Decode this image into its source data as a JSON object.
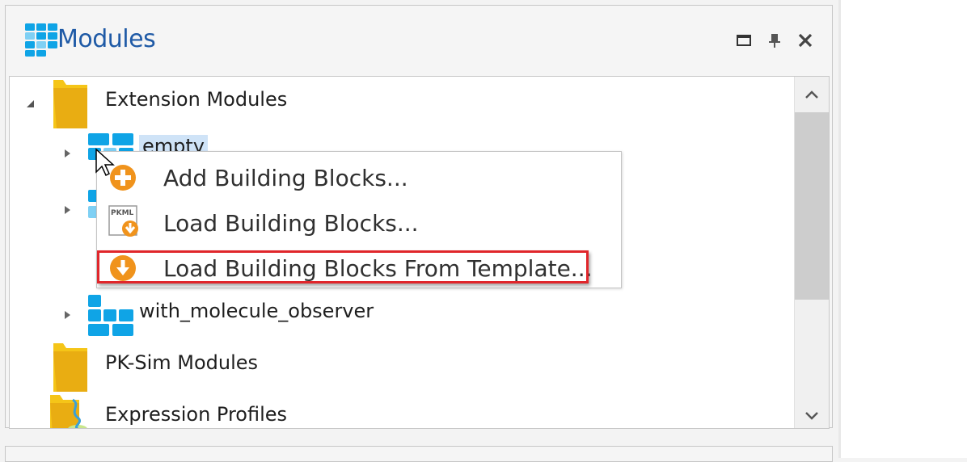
{
  "panel": {
    "title": "Modules",
    "buttons": [
      {
        "name": "maximize",
        "icon": "maximize-icon"
      },
      {
        "name": "pin",
        "icon": "pin-icon"
      },
      {
        "name": "close",
        "icon": "close-icon"
      }
    ]
  },
  "tree": {
    "nodes": [
      {
        "label": "Extension Modules",
        "icon": "folder-icon",
        "expanded": true
      },
      {
        "label": "empty",
        "icon": "module-icon",
        "selected": true
      },
      {
        "label": "",
        "icon": "module-icon"
      },
      {
        "label": "with_molecule_observer",
        "icon": "module-icon"
      },
      {
        "label": "PK-Sim Modules",
        "icon": "folder-icon"
      },
      {
        "label": "Expression Profiles",
        "icon": "expression-profiles-icon"
      }
    ]
  },
  "context_menu": {
    "items": [
      {
        "label": "Add Building Blocks...",
        "icon": "add-icon"
      },
      {
        "label": "Load Building Blocks...",
        "icon": "pkml-load-icon",
        "icon_text": "PKML"
      },
      {
        "label": "Load Building Blocks From Template...",
        "icon": "download-icon",
        "highlighted": true
      }
    ]
  },
  "colors": {
    "title": "#1f5aa6",
    "module_blue": "#0fa4e6",
    "module_light": "#7fd0f4",
    "folder": "#f5c518",
    "menu_icon_orange": "#f0931c",
    "highlight_border": "#e0262b",
    "selection": "#cfe3f7"
  }
}
